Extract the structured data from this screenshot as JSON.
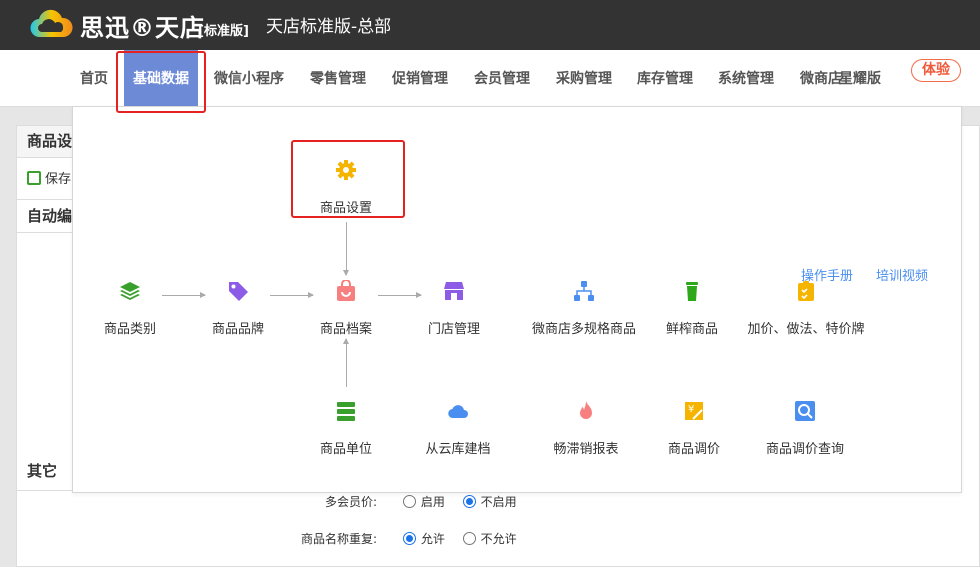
{
  "header": {
    "brand": "思迅®天店",
    "edition": "[标准版]",
    "store": "天店标准版-总部"
  },
  "nav": {
    "items": [
      "首页",
      "基础数据",
      "微信小程序",
      "零售管理",
      "促销管理",
      "会员管理",
      "采购管理",
      "库存管理",
      "系统管理",
      "微商店",
      "星耀版"
    ],
    "active": "基础数据",
    "badge": "体验"
  },
  "page": {
    "section_title": "商品设",
    "save": "保存",
    "auto_code": "自动编",
    "other": "其它",
    "settings": [
      {
        "label": "多会员价:",
        "options": [
          "启用",
          "不启用"
        ],
        "selected": "不启用"
      },
      {
        "label": "商品名称重复:",
        "options": [
          "允许",
          "不允许"
        ],
        "selected": "允许"
      }
    ]
  },
  "dropdown": {
    "links": [
      "操作手册",
      "培训视频"
    ],
    "top": {
      "label": "商品设置",
      "icon": "gear-icon",
      "color": "#f5b400"
    },
    "row1": [
      {
        "label": "商品类别",
        "icon": "layers-icon",
        "color": "#3aa02d"
      },
      {
        "label": "商品品牌",
        "icon": "tag-icon",
        "color": "#8c5ce6"
      },
      {
        "label": "商品档案",
        "icon": "shopping-bag-icon",
        "color": "#f77f7f"
      },
      {
        "label": "门店管理",
        "icon": "storefront-icon",
        "color": "#8c5ce6"
      },
      {
        "label": "微商店多规格商品",
        "icon": "hierarchy-icon",
        "color": "#4a8ff0"
      },
      {
        "label": "鲜榨商品",
        "icon": "cup-icon",
        "color": "#2ea81b"
      },
      {
        "label": "加价、做法、特价牌",
        "icon": "checklist-icon",
        "color": "#f5b400"
      }
    ],
    "row2": [
      {
        "label": "商品单位",
        "icon": "stack-icon",
        "color": "#3aa02d"
      },
      {
        "label": "从云库建档",
        "icon": "cloud-icon",
        "color": "#4a8ff0"
      },
      {
        "label": "畅滞销报表",
        "icon": "fire-icon",
        "color": "#f77f7f"
      },
      {
        "label": "商品调价",
        "icon": "price-edit-icon",
        "color": "#f5b400"
      },
      {
        "label": "商品调价查询",
        "icon": "price-search-icon",
        "color": "#4a8ff0"
      }
    ]
  }
}
